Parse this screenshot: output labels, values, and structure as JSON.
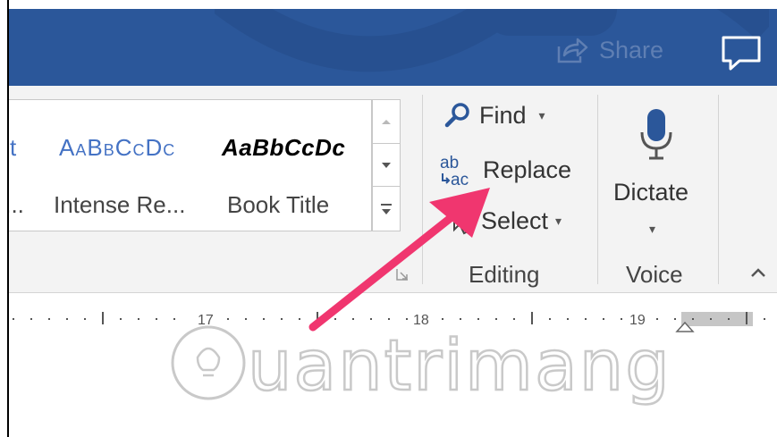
{
  "title_bar": {
    "share_label": "Share",
    "share_icon": "share-icon",
    "comment_icon": "comment-icon",
    "background_color": "#2b579a"
  },
  "styles_gallery": {
    "items": [
      {
        "sample": "ɔt",
        "name": "f..."
      },
      {
        "sample": "AaBbCcDc",
        "name": "Intense Re..."
      },
      {
        "sample": "AaBbCcDc",
        "name": "Book Title"
      }
    ],
    "scroll_icons": [
      "scroll-up-icon",
      "scroll-down-icon",
      "more-styles-icon"
    ],
    "launcher_icon": "dialog-launcher-icon"
  },
  "editing_group": {
    "find_label": "Find",
    "replace_label": "Replace",
    "select_label": "Select",
    "group_label": "Editing",
    "icons": [
      "search-icon",
      "replace-icon",
      "select-icon"
    ]
  },
  "voice_group": {
    "dictate_label": "Dictate",
    "group_label": "Voice",
    "icon": "microphone-icon"
  },
  "ruler": {
    "labels": [
      "17",
      "18",
      "19"
    ]
  },
  "watermark": {
    "text": "uantrimang"
  },
  "annotation": {
    "arrow_color": "#f0366f"
  }
}
